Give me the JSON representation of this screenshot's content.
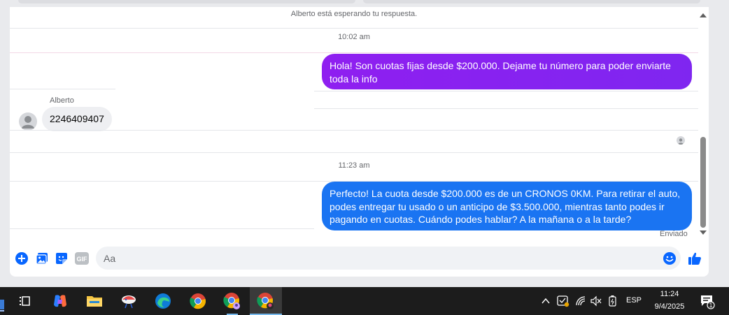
{
  "colors": {
    "outgoing_purple": "#8a2be2",
    "outgoing_blue": "#1a74f2",
    "incoming_gray": "#eeeff2",
    "accent_blue": "#0866ff"
  },
  "conversation": {
    "waiting_notice": "Alberto está esperando tu respuesta.",
    "timestamp_1": "10:02 am",
    "message_1": "Hola! Son cuotas fijas desde $200.000. Dejame tu número para poder enviarte toda la info",
    "sender_name": "Alberto",
    "message_2": "2246409407",
    "timestamp_2": "11:23 am",
    "message_3": "Perfecto! La cuota desde $200.000 es de un CRONOS 0KM. Para retirar el auto, podes entregar tu usado o un anticipo de $3.500.000, mientras tanto podes ir pagando en cuotas. Cuándo podes hablar? A la mañana o a la tarde?",
    "status": "Enviado"
  },
  "composer": {
    "placeholder": "Aa",
    "icons": [
      "add-icon",
      "image-icon",
      "sticker-icon",
      "gif-icon",
      "emoji-icon",
      "like-icon"
    ],
    "gif_label": "GIF"
  },
  "taskbar": {
    "apps": [
      "task-view",
      "copilot",
      "file-explorer",
      "app-bird",
      "edge",
      "chrome",
      "chrome-profile-1",
      "chrome-profile-2"
    ],
    "language": "ESP",
    "time": "11:24",
    "date": "9/4/2025",
    "notification_count": "1"
  }
}
